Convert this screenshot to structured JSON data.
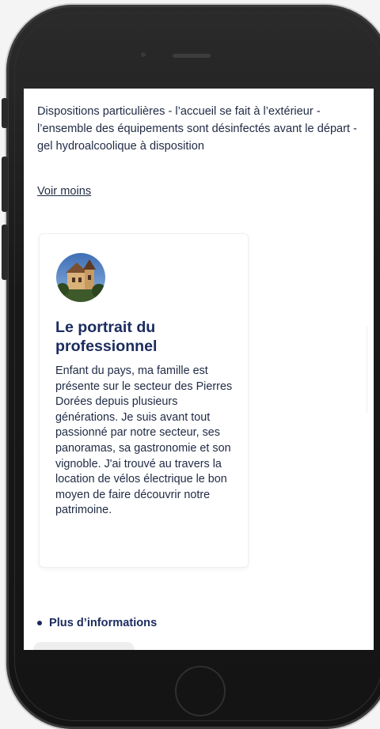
{
  "screen": {
    "dispositions_text": "Dispositions particulières - l’accueil se fait à l’extérieur - l’ensemble des équipements sont désinfectés avant le départ - gel hydroalcoolique à disposition",
    "toggle_link": "Voir moins"
  },
  "portrait": {
    "title": "Le portrait du professionnel",
    "body": "Enfant du pays, ma famille est présente sur le secteur des Pierres Dorées depuis plusieurs générations. Je suis avant tout passionné par notre secteur, ses panoramas, sa gastronomie et son vignoble. J'ai trouvé au travers la location de vélos électrique le bon moyen de faire découvrir notre patrimoine.",
    "avatar_icon": "chateau-photo"
  },
  "more": {
    "heading": "Plus d’informations"
  },
  "colors": {
    "primary_text": "#1f2a44",
    "title_navy": "#1a2b5e"
  }
}
